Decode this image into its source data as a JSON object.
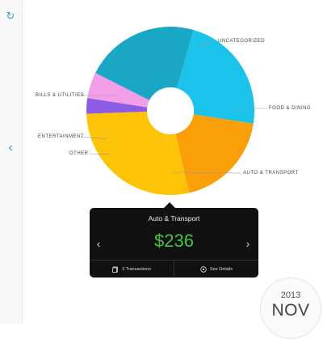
{
  "colors": {
    "uncategorized": "#1bc2e9",
    "food_dining": "#fb9f08",
    "auto_transport": "#fdc407",
    "other": "#8d5ce6",
    "entertainment": "#f29ee8",
    "bills_utilities": "#1aa6c5",
    "popover_bg": "#111111",
    "amount": "#45c146",
    "accent": "#2aa3d8"
  },
  "sidebar": {
    "refresh_icon": "refresh-icon",
    "back_icon": "chevron-left-icon"
  },
  "chart_data": {
    "type": "pie",
    "categories": [
      "UNCATEGORIZED",
      "FOOD & DINING",
      "AUTO & TRANSPORT",
      "OTHER",
      "ENTERTAINMENT",
      "BILLS & UTILITIES"
    ],
    "values": [
      23,
      19,
      28,
      3,
      5,
      22
    ],
    "donut": true,
    "legend": "labels-outside"
  },
  "popover": {
    "title": "Auto & Transport",
    "amount": "$236",
    "transactions_label": "3 Transactions",
    "details_label": "See Details",
    "prev_icon": "chevron-left-icon",
    "next_icon": "chevron-right-icon"
  },
  "date": {
    "year": "2013",
    "month": "NOV"
  }
}
